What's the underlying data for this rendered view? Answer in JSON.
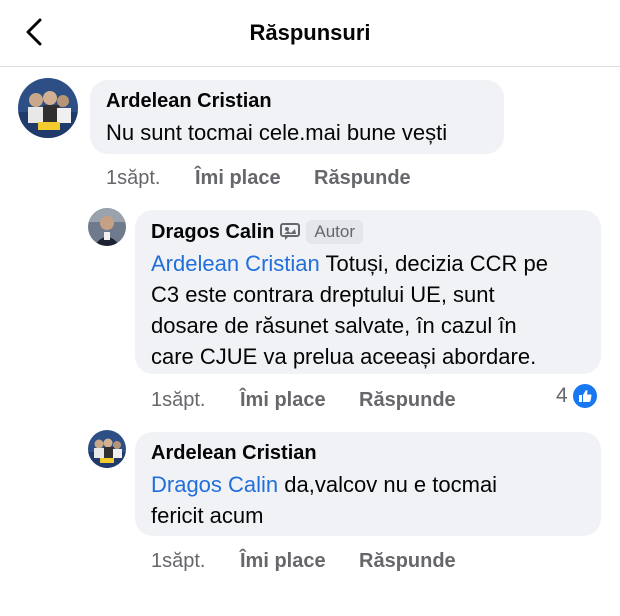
{
  "header": {
    "title": "Răspunsuri"
  },
  "comments": [
    {
      "author": "Ardelean Cristian",
      "mention": "",
      "lines": [
        "Nu sunt tocmai cele.mai bune vești"
      ],
      "time": "1săpt.",
      "like_label": "Îmi place",
      "reply_label": "Răspunde"
    },
    {
      "author": "Dragos Calin",
      "badge": "Autor",
      "mention": "Ardelean Cristian",
      "line1_rest": " Totuși, decizia CCR pe",
      "lines": [
        "C3 este contrara dreptului UE, sunt",
        "dosare de răsunet salvate, în cazul în",
        "care CJUE va prelua aceeași abordare."
      ],
      "time": "1săpt.",
      "like_label": "Îmi place",
      "reply_label": "Răspunde",
      "reaction_count": "4"
    },
    {
      "author": "Ardelean Cristian",
      "mention": "Dragos Calin",
      "line1_rest": " da,valcov nu e tocmai",
      "lines": [
        "fericit acum"
      ],
      "time": "1săpt.",
      "like_label": "Îmi place",
      "reply_label": "Răspunde"
    }
  ],
  "colors": {
    "mention": "#216fdb",
    "bubble": "#f0f2f5",
    "like_blue": "#1877f2"
  }
}
